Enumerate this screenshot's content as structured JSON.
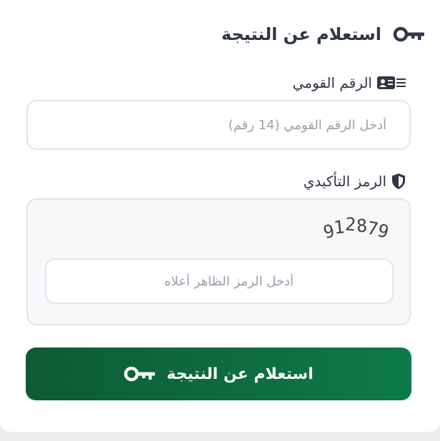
{
  "form": {
    "title": "استعلام عن النتيجة",
    "title_icon": "key-icon",
    "national_id": {
      "label": "الرقم القومي",
      "icon": "id-card-icon",
      "placeholder": "أدخل الرقم القومي (14 رقم)"
    },
    "captcha": {
      "label": "الرمز التأكيدي",
      "icon": "shield-icon",
      "code": "912879",
      "placeholder": "أدخل الرمز الظاهر أعلاه"
    },
    "submit": {
      "label": "استعلام عن النتيجة",
      "icon": "key-icon"
    }
  },
  "colors": {
    "primary": "#0e7a47",
    "primary_dark": "#0d5b33",
    "text": "#2f3747",
    "border": "#dfe5ee",
    "placeholder": "#98a1ad"
  }
}
